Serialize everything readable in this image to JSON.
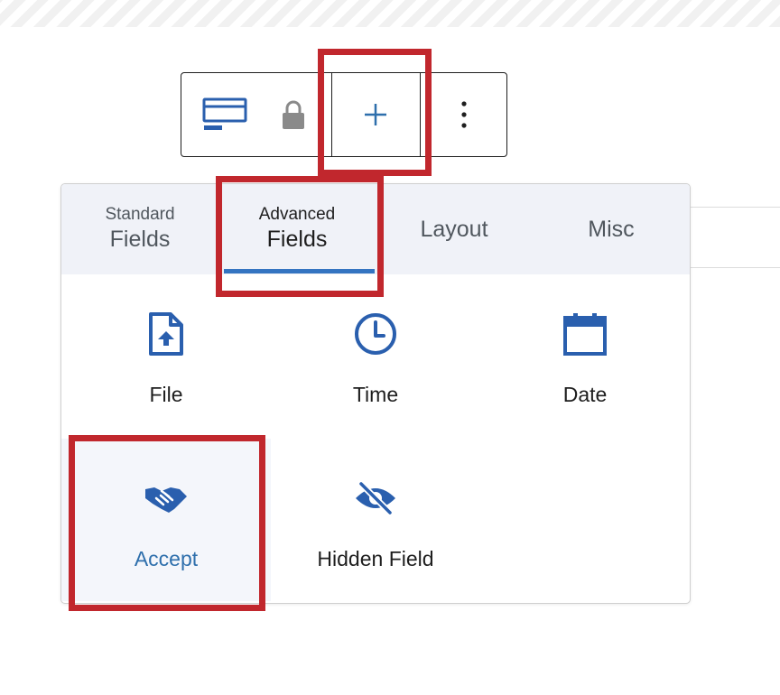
{
  "toolbar": {
    "buttons": [
      {
        "name": "form-block-icon"
      },
      {
        "name": "lock-icon"
      },
      {
        "name": "add-field-button",
        "label": "+"
      },
      {
        "name": "more-options-button",
        "label": "⋮"
      }
    ]
  },
  "tabs": [
    {
      "small": "Standard",
      "big": "Fields",
      "active": false
    },
    {
      "small": "Advanced",
      "big": "Fields",
      "active": true
    },
    {
      "small": "",
      "big": "Layout",
      "active": false
    },
    {
      "small": "",
      "big": "Misc",
      "active": false
    }
  ],
  "fields": [
    {
      "label": "File",
      "icon": "file-upload-icon"
    },
    {
      "label": "Time",
      "icon": "clock-icon"
    },
    {
      "label": "Date",
      "icon": "calendar-icon"
    },
    {
      "label": "Accept",
      "icon": "handshake-icon",
      "selected": true
    },
    {
      "label": "Hidden Field",
      "icon": "eye-slash-icon"
    }
  ],
  "colors": {
    "accent": "#3474c1",
    "icon_blue": "#2a5fae",
    "highlight": "#c1272d",
    "tab_bg": "#f0f2f8"
  }
}
